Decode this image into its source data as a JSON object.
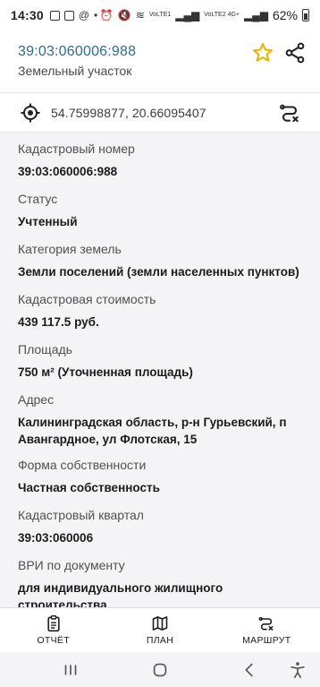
{
  "status_bar": {
    "time": "14:30",
    "signal_1": "VoLTE1",
    "signal_2": "VoLTE2 4G+",
    "battery_percent": "62%"
  },
  "header": {
    "cadastral_number": "39:03:060006:988",
    "object_type": "Земельный участок",
    "star_icon": "star-outline-icon",
    "share_icon": "share-icon",
    "star_color": "#e6b800"
  },
  "coords": {
    "text": "54.75998877, 20.66095407",
    "target_icon": "crosshair-icon",
    "route_icon": "route-icon"
  },
  "details": [
    {
      "label": "Кадастровый номер",
      "value": "39:03:060006:988"
    },
    {
      "label": "Статус",
      "value": "Учтенный"
    },
    {
      "label": "Категория земель",
      "value": "Земли поселений (земли населенных пунктов)"
    },
    {
      "label": "Кадастровая стоимость",
      "value": "439 117.5 руб."
    },
    {
      "label": "Площадь",
      "value": "750 м² (Уточненная площадь)"
    },
    {
      "label": "Адрес",
      "value": "Калининградская область, р-н Гурьевский, п Авангардное, ул Флотская, 15"
    },
    {
      "label": "Форма собственности",
      "value": "Частная собственность"
    },
    {
      "label": "Кадастровый квартал",
      "value": "39:03:060006"
    },
    {
      "label": "ВРИ по документу",
      "value": "для индивидуального жилищного строительства"
    }
  ],
  "bottom_nav": {
    "report_label": "ОТЧЁТ",
    "plan_label": "ПЛАН",
    "route_label": "МАРШРУТ"
  },
  "colors": {
    "accent_link": "#2d6c92",
    "background": "#f4f4f6",
    "surface": "#ffffff"
  }
}
